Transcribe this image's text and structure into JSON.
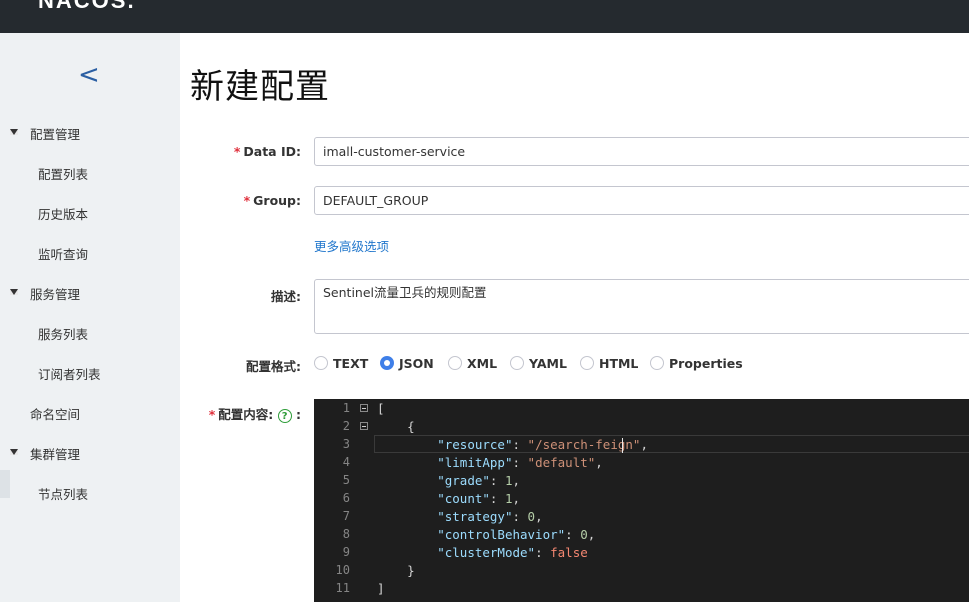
{
  "header": {
    "logo": "NACOS."
  },
  "sidebar": {
    "collapse_glyph": "<",
    "groups": [
      {
        "label": "配置管理",
        "items": [
          "配置列表",
          "历史版本",
          "监听查询"
        ]
      },
      {
        "label": "服务管理",
        "items": [
          "服务列表",
          "订阅者列表"
        ]
      },
      {
        "label": "命名空间",
        "items": []
      },
      {
        "label": "集群管理",
        "items": [
          "节点列表"
        ]
      }
    ]
  },
  "page": {
    "title": "新建配置"
  },
  "form": {
    "required_mark": "*",
    "data_id": {
      "label": "Data ID:",
      "value": "imall-customer-service"
    },
    "group": {
      "label": "Group:",
      "value": "DEFAULT_GROUP"
    },
    "advanced_link": "更多高级选项",
    "description": {
      "label": "描述:",
      "value": "Sentinel流量卫兵的规则配置"
    },
    "format": {
      "label": "配置格式:",
      "options": [
        "TEXT",
        "JSON",
        "XML",
        "YAML",
        "HTML",
        "Properties"
      ],
      "selected": "JSON"
    },
    "content": {
      "label": "配置内容:",
      "help_glyph": "?",
      "colon": ":"
    }
  },
  "editor": {
    "line_numbers": [
      "1",
      "2",
      "3",
      "4",
      "5",
      "6",
      "7",
      "8",
      "9",
      "10",
      "11"
    ],
    "lines": [
      "[",
      "    {",
      "        \"resource\": \"/search-feign\",",
      "        \"limitApp\": \"default\",",
      "        \"grade\": 1,",
      "        \"count\": 1,",
      "        \"strategy\": 0,",
      "        \"controlBehavior\": 0,",
      "        \"clusterMode\": false",
      "    }",
      "]"
    ],
    "tokens": {
      "open_bracket": "[",
      "open_brace": "{",
      "resource_key": "\"resource\"",
      "resource_val": "\"/search-feign\"",
      "limitApp_key": "\"limitApp\"",
      "limitApp_val": "\"default\"",
      "grade_key": "\"grade\"",
      "grade_val": "1",
      "count_key": "\"count\"",
      "count_val": "1",
      "strategy_key": "\"strategy\"",
      "strategy_val": "0",
      "controlBehavior_key": "\"controlBehavior\"",
      "controlBehavior_val": "0",
      "clusterMode_key": "\"clusterMode\"",
      "clusterMode_val": "false",
      "close_brace": "}",
      "close_bracket": "]"
    }
  },
  "colors": {
    "topbar": "#252a2f",
    "sidebar": "#eef1f3",
    "accent_blue": "#3f7fe8",
    "link_blue": "#2277cc",
    "required_red": "#e0303c",
    "editor_bg": "#1e1e1e",
    "json_key": "#9cdcfe",
    "json_string": "#ce9178",
    "json_number": "#b5cea8"
  }
}
